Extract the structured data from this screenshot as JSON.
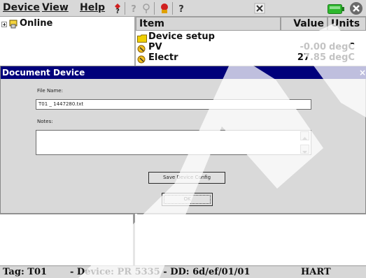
{
  "menubar": {
    "device": "Device",
    "view": "View",
    "help": "Help",
    "icons": [
      "help-question-icon",
      "disabled-help-icon",
      "disabled-pin-icon",
      "badge-icon",
      "question-icon",
      "close-x-icon",
      "battery-icon",
      "window-close-icon"
    ]
  },
  "tree": {
    "root_label": "Online"
  },
  "table": {
    "headers": {
      "item": "Item",
      "value": "Value",
      "units": "Units"
    },
    "rows": [
      {
        "item": "Device setup",
        "value": "",
        "units": ""
      },
      {
        "item": "PV",
        "value": "-0.00",
        "units": "degC"
      },
      {
        "item": "Electr",
        "value": "27.85",
        "units": "degC"
      }
    ]
  },
  "dialog": {
    "title": "Document Device",
    "file_name_label": "File Name:",
    "file_name_value": "T01   _   1447280.txt",
    "notes_label": "Notes:",
    "notes_value": "",
    "save_button": "Save Device Config",
    "ok_button": "OK",
    "close_glyph": "×"
  },
  "status": {
    "tag": "Tag: T01",
    "device": "- Device: PR 5335 - DD: 6d/ef/01/01",
    "protocol": "HART"
  },
  "colors": {
    "dialog_title_bg": "#00007b",
    "battery_green": "#2eb82e",
    "folder_yellow": "#f0d000"
  }
}
